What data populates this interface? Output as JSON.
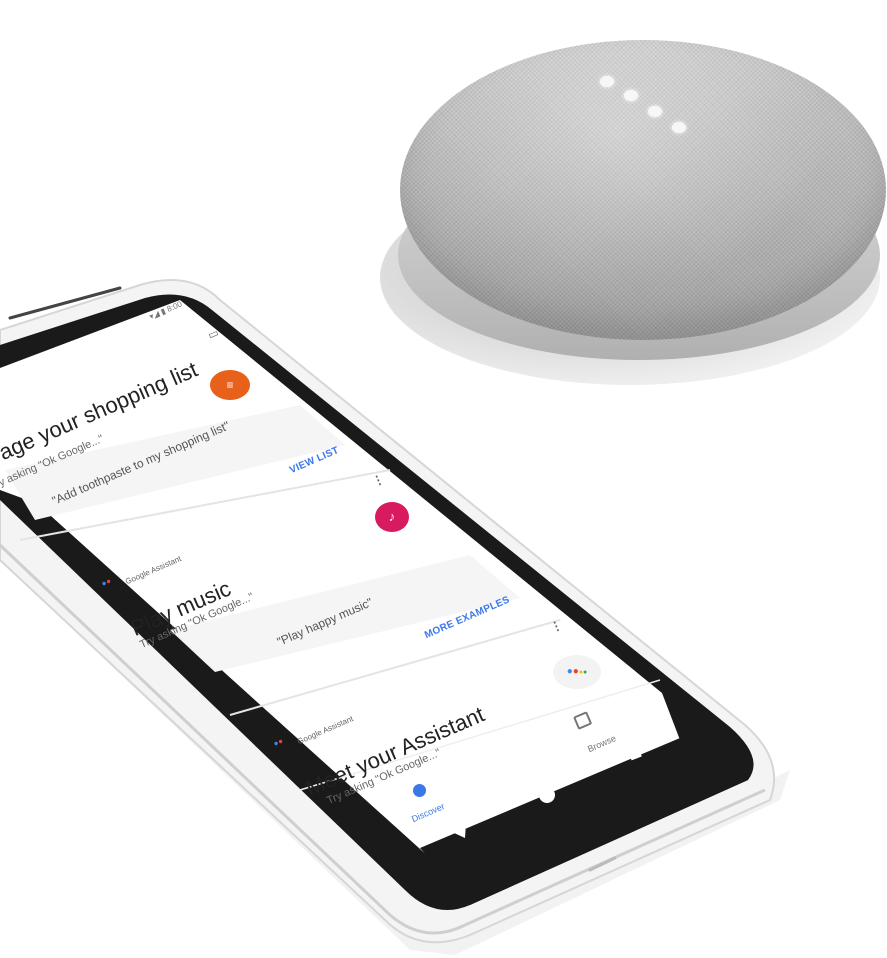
{
  "status_bar": {
    "time": "8:00"
  },
  "cards": [
    {
      "title": "age your shopping list",
      "subtitle": "y asking \"Ok Google...\"",
      "quote": "\"Add toothpaste to my shopping list\"",
      "action": "VIEW LIST",
      "icon": "list-icon",
      "icon_color": "#e8611a"
    },
    {
      "source": "Google Assistant",
      "title": "Play music",
      "subtitle": "Try asking \"Ok Google...\"",
      "quote": "\"Play happy music\"",
      "action": "MORE EXAMPLES",
      "icon": "music-note-icon",
      "icon_color": "#d81b60"
    },
    {
      "source": "Google Assistant",
      "title": "Meet your Assistant",
      "subtitle": "Try asking \"Ok Google...\"",
      "icon": "assistant-logo-icon"
    }
  ],
  "bottom_nav": {
    "discover": "Discover",
    "browse": "Browse",
    "active_color": "#3b78e7"
  },
  "colors": {
    "phone_body": "#f4f4f4",
    "bezel": "#1a1a1a",
    "screen_bg": "#ffffff",
    "speaker_fabric": "#bcbcbc"
  }
}
